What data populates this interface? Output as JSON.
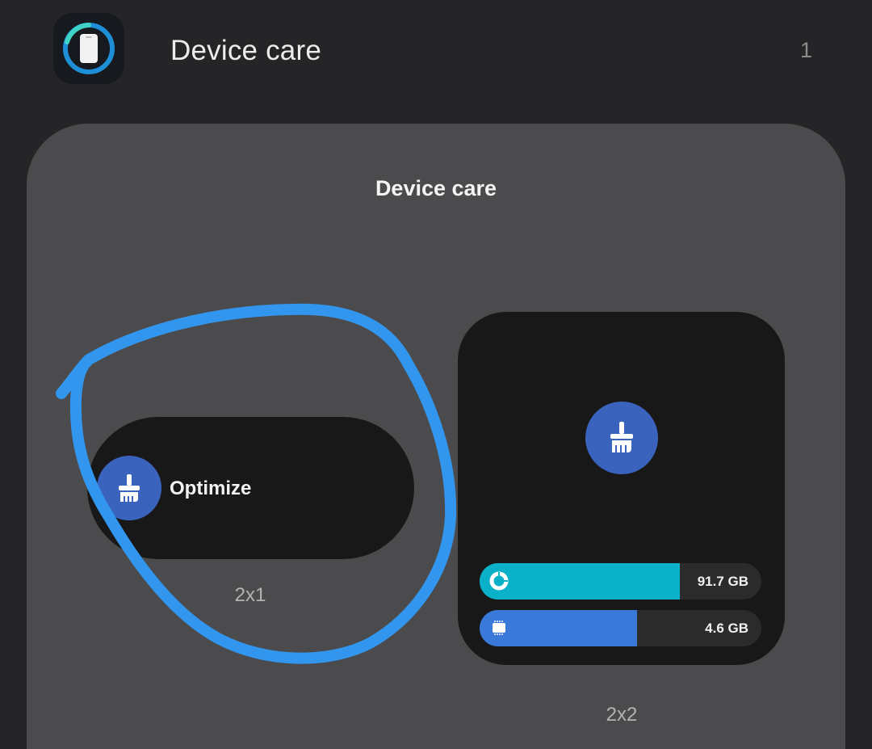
{
  "header": {
    "app_icon": "device-care-icon",
    "title": "Device care",
    "widget_count": "1"
  },
  "preview": {
    "title": "Device care",
    "widgets": [
      {
        "size_label": "2x1",
        "icon": "broom-icon",
        "label": "Optimize"
      },
      {
        "size_label": "2x2",
        "icon": "broom-icon",
        "bars": [
          {
            "icon": "storage-pie-icon",
            "value_text": "91.7 GB",
            "fill_fraction": 0.71,
            "color": "#0bb0c9"
          },
          {
            "icon": "memory-chip-icon",
            "value_text": "4.6 GB",
            "fill_fraction": 0.56,
            "color": "#3a78d9"
          }
        ]
      }
    ]
  },
  "colors": {
    "background": "#252527",
    "panel": "#4b4b4d",
    "widget": "#181818",
    "accent_blue": "#3a63bd",
    "annotation": "#3296ee"
  }
}
